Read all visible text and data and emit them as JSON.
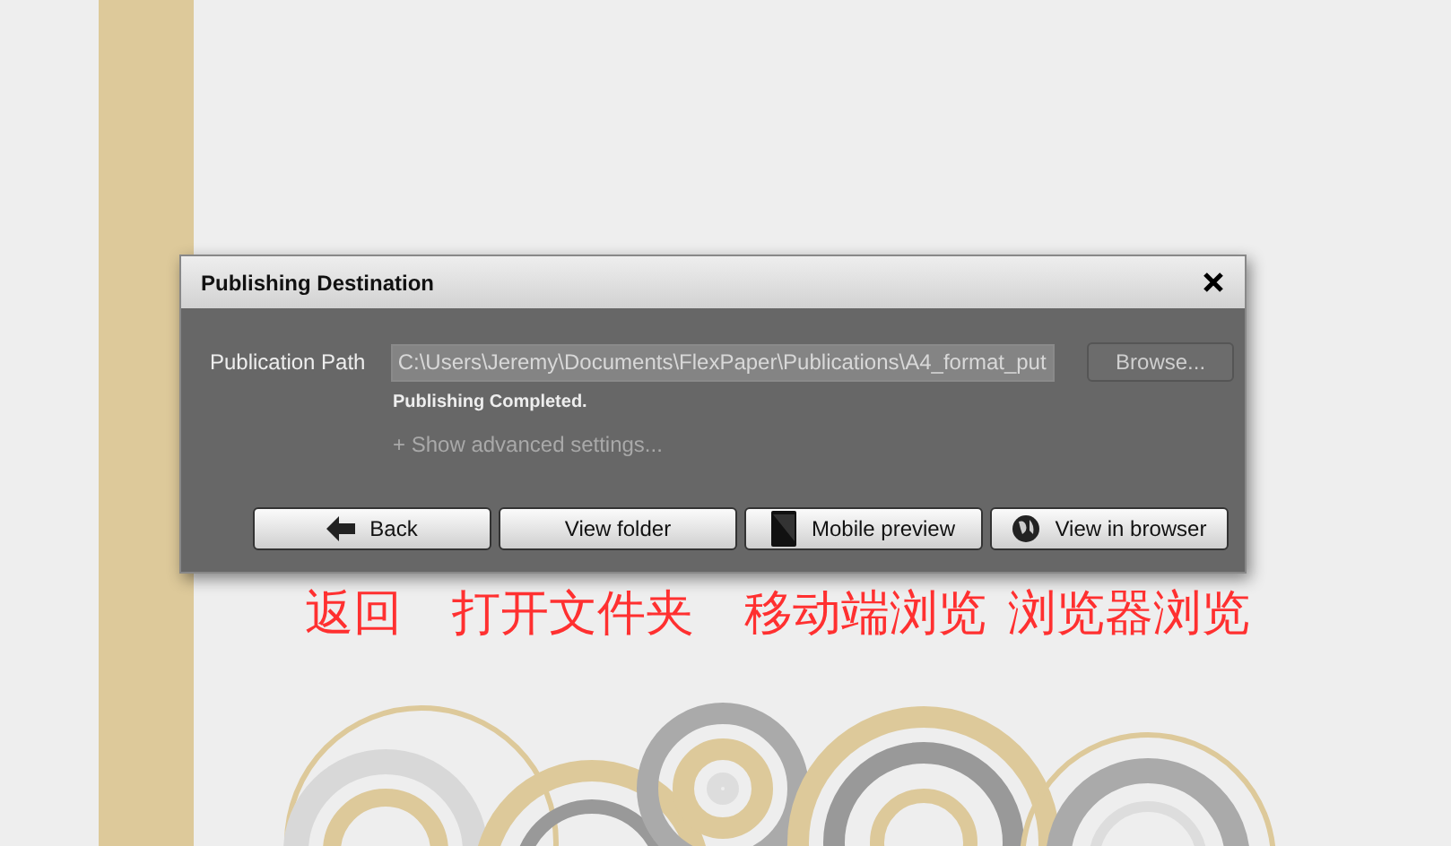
{
  "dialog": {
    "title": "Publishing Destination",
    "path_label": "Publication Path",
    "path_field": {
      "value": "C:\\Users\\Jeremy\\Documents\\FlexPaper\\Publications\\A4_format_put",
      "disabled": true
    },
    "browse_button": {
      "label": "Browse...",
      "disabled": true
    },
    "status": "Publishing Completed.",
    "advanced_link": "+ Show advanced settings...",
    "buttons": [
      {
        "label": "Back",
        "kind": "back"
      },
      {
        "label": "View folder",
        "kind": "plain"
      },
      {
        "label": "Mobile preview",
        "kind": "tablet"
      },
      {
        "label": "View in browser",
        "kind": "globe"
      }
    ]
  },
  "annotations": [
    "返回",
    "打开文件夹",
    "移动端浏览",
    "浏览器浏览"
  ]
}
